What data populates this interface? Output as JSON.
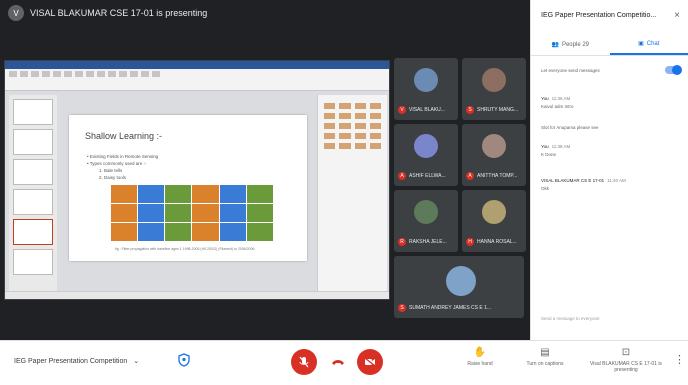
{
  "presenter_banner": {
    "initial": "V",
    "text": "VISAL BLAKUMAR CSE 17-01 is presenting"
  },
  "slide": {
    "title": "Shallow Learning :-",
    "bullets": [
      "• Existing Fields in Remote Sensing",
      "• Types commonly used are :-",
      "1. Bale tells",
      "2. Daisy tools"
    ],
    "caption": "fig : Fitter propagation with baseline ages 1 1998-2005 (HIC/DSG) (Filamed) to 2006/2006"
  },
  "participants": [
    {
      "initial": "V",
      "name": "VISAL BLAKU..."
    },
    {
      "initial": "S",
      "name": "SHRUTY MANG..."
    },
    {
      "initial": "A",
      "name": "ASHIF ELLWA..."
    },
    {
      "initial": "A",
      "name": "ANITTHA TOMP..."
    },
    {
      "initial": "R",
      "name": "RAKSHA JELE..."
    },
    {
      "initial": "H",
      "name": "HANNA ROSAL..."
    },
    {
      "initial": "S",
      "name": "SUMATH ANDREY JAMES CS E 1..."
    }
  ],
  "bottom_bar": {
    "meeting_title": "IEG Paper Presentation Competition",
    "chevron": "⌄",
    "actions": [
      {
        "icon": "✋",
        "label": "Raise hand"
      },
      {
        "icon": "▤",
        "label": "Turn on captions"
      },
      {
        "icon": "⊡",
        "label": "Visal BLAKUMAR CS E 17-01 is presenting"
      }
    ],
    "more": "⋮"
  },
  "side_panel": {
    "title": "IEG Paper Presentation Competitio...",
    "close": "×",
    "tabs": [
      {
        "icon": "👥",
        "label": "People 29"
      },
      {
        "icon": "▣",
        "label": "Chat"
      }
    ],
    "toggle_label": "Let everyone send messages",
    "messages": [
      {
        "who": "You",
        "time": "11:36 AM",
        "text": "Kaivul adm Intro"
      },
      {
        "who": "",
        "time": "",
        "text": "Slot for Anupama please see"
      },
      {
        "who": "You",
        "time": "11:38 AM",
        "text": "K Done"
      },
      {
        "who": "VISAL BLAKUMAR CS E 17-01",
        "time": "11:40 AM",
        "text": "Okk"
      }
    ],
    "input_placeholder": "Send a message to everyone"
  }
}
